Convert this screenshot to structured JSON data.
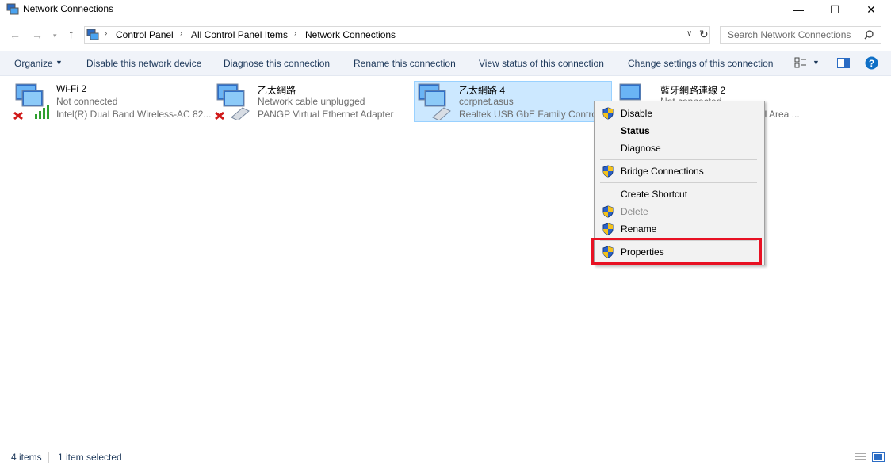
{
  "window": {
    "title": "Network Connections"
  },
  "titlebar_buttons": {
    "minimize": "—",
    "maximize": "☐",
    "close": "✕"
  },
  "breadcrumb": [
    "Control Panel",
    "All Control Panel Items",
    "Network Connections"
  ],
  "search": {
    "placeholder": "Search Network Connections"
  },
  "commands": {
    "organize": "Organize",
    "disable": "Disable this network device",
    "diagnose": "Diagnose this connection",
    "rename": "Rename this connection",
    "view_status": "View status of this connection",
    "change_settings": "Change settings of this connection"
  },
  "connections": [
    {
      "name": "Wi-Fi 2",
      "status": "Not connected",
      "adapter": "Intel(R) Dual Band Wireless-AC 82..."
    },
    {
      "name": "乙太網路",
      "status": "Network cable unplugged",
      "adapter": "PANGP Virtual Ethernet Adapter"
    },
    {
      "name": "乙太網路 4",
      "status": "corpnet.asus",
      "adapter": "Realtek USB GbE Family Controll"
    },
    {
      "name": "藍牙網路連線 2",
      "status": "Not connected",
      "adapter": "al Area ..."
    }
  ],
  "context_menu": {
    "disable": "Disable",
    "status": "Status",
    "diagnose": "Diagnose",
    "bridge": "Bridge Connections",
    "shortcut": "Create Shortcut",
    "delete": "Delete",
    "rename": "Rename",
    "properties": "Properties"
  },
  "statusbar": {
    "count": "4 items",
    "selected": "1 item selected"
  },
  "colors": {
    "highlight": "#e81123",
    "selection": "#cce8ff",
    "cmd_text": "#1e395b"
  }
}
